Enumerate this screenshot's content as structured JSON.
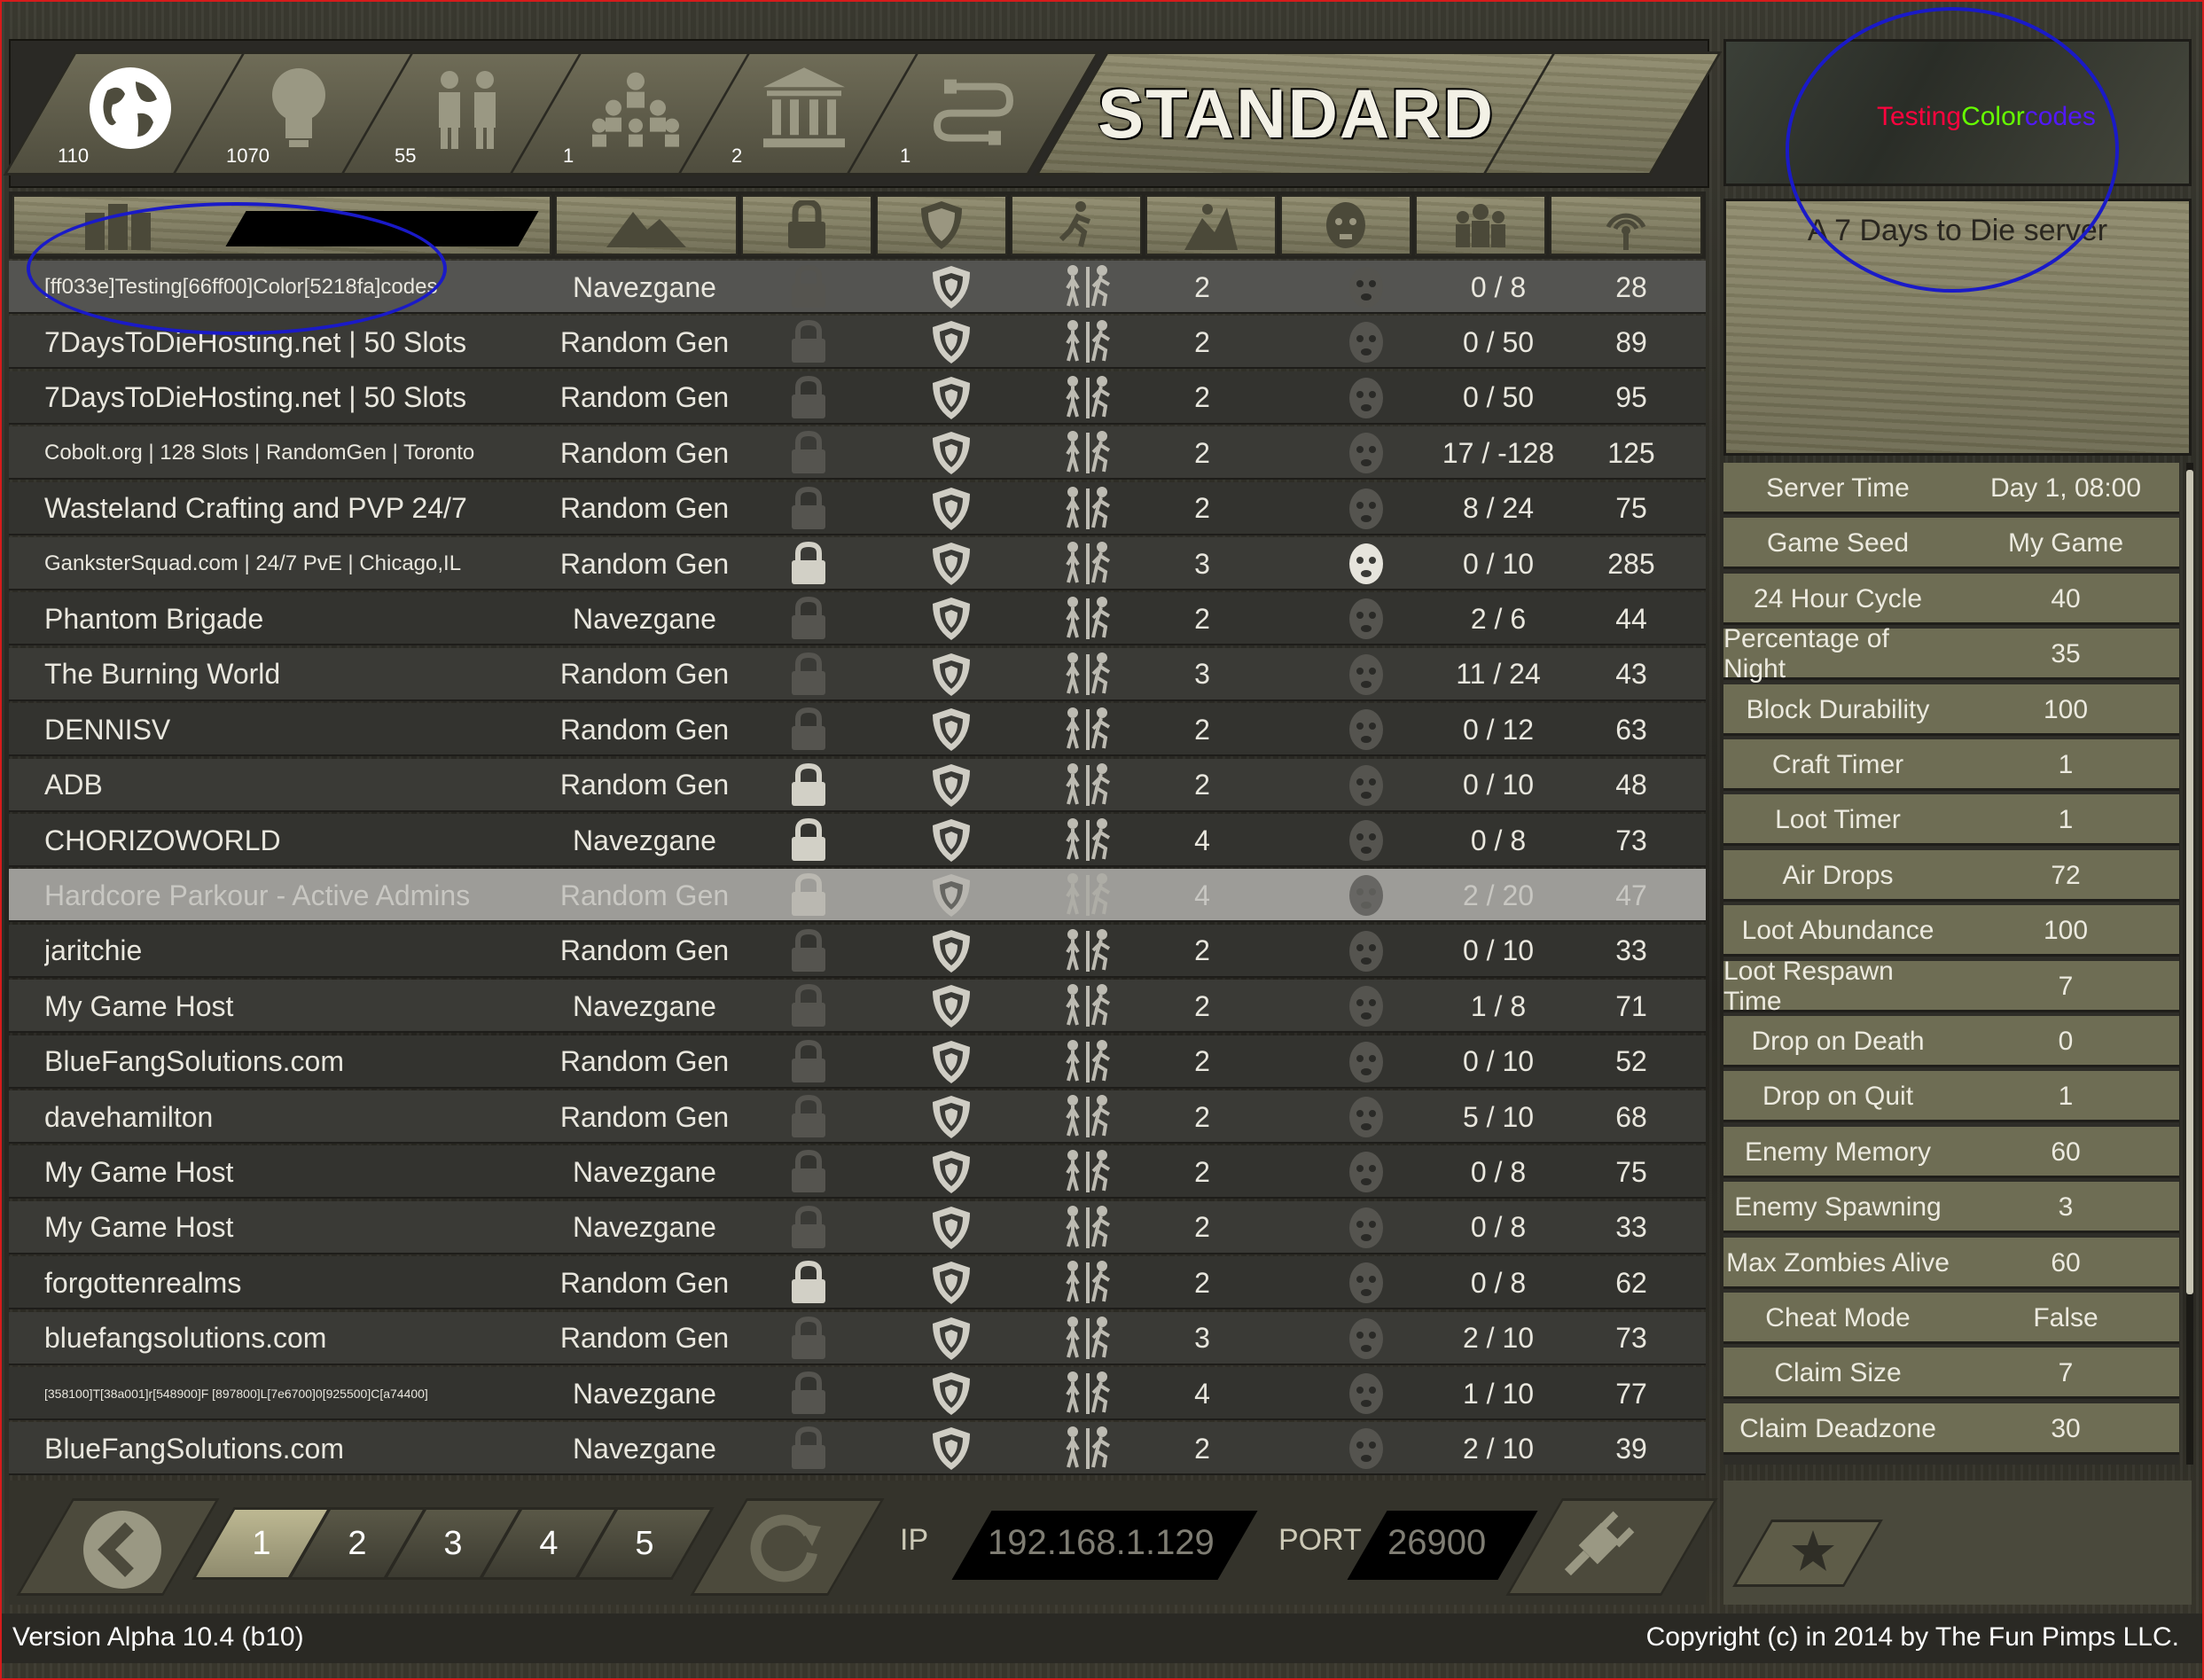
{
  "tabs": [
    {
      "icon": "globe-icon",
      "count": "110"
    },
    {
      "icon": "lightbulb-icon",
      "count": "1070"
    },
    {
      "icon": "friends-icon",
      "count": "55"
    },
    {
      "icon": "group-icon",
      "count": "1"
    },
    {
      "icon": "bank-icon",
      "count": "2"
    },
    {
      "icon": "lan-icon",
      "count": "1"
    }
  ],
  "mode_label": "STANDARD",
  "columns": [
    "server-name",
    "world",
    "password",
    "anticheat",
    "sprint",
    "difficulty",
    "zombie-run",
    "players",
    "ping"
  ],
  "servers": [
    {
      "name": "[ff033e]Testing[66ff00]Color[5218fa]codes",
      "world": "Navezgane",
      "locked": false,
      "difficulty": "2",
      "zombie": "dim",
      "players": "0 / 8",
      "ping": "28",
      "style": "hl",
      "size": "small"
    },
    {
      "name": "7DaysToDieHosting.net | 50 Slots",
      "world": "Random Gen",
      "locked": false,
      "difficulty": "2",
      "zombie": "dim",
      "players": "0 / 50",
      "ping": "89",
      "style": "",
      "size": ""
    },
    {
      "name": "7DaysToDieHosting.net | 50 Slots",
      "world": "Random Gen",
      "locked": false,
      "difficulty": "2",
      "zombie": "dim",
      "players": "0 / 50",
      "ping": "95",
      "style": "",
      "size": ""
    },
    {
      "name": "Cobolt.org | 128 Slots | RandomGen | Toronto",
      "world": "Random Gen",
      "locked": false,
      "difficulty": "2",
      "zombie": "dim",
      "players": "17 / -128",
      "ping": "125",
      "style": "",
      "size": "small"
    },
    {
      "name": "Wasteland Crafting and PVP 24/7",
      "world": "Random Gen",
      "locked": false,
      "difficulty": "2",
      "zombie": "dim",
      "players": "8 / 24",
      "ping": "75",
      "style": "",
      "size": ""
    },
    {
      "name": "GanksterSquad.com | 24/7 PvE | Chicago,IL",
      "world": "Random Gen",
      "locked": true,
      "difficulty": "3",
      "zombie": "bright",
      "players": "0 / 10",
      "ping": "285",
      "style": "",
      "size": "small"
    },
    {
      "name": "Phantom Brigade",
      "world": "Navezgane",
      "locked": false,
      "difficulty": "2",
      "zombie": "dim",
      "players": "2 / 6",
      "ping": "44",
      "style": "",
      "size": ""
    },
    {
      "name": "The Burning World",
      "world": "Random Gen",
      "locked": false,
      "difficulty": "3",
      "zombie": "dim",
      "players": "11 / 24",
      "ping": "43",
      "style": "",
      "size": ""
    },
    {
      "name": "DENNISV",
      "world": "Random Gen",
      "locked": false,
      "difficulty": "2",
      "zombie": "dim",
      "players": "0 / 12",
      "ping": "63",
      "style": "",
      "size": ""
    },
    {
      "name": "ADB",
      "world": "Random Gen",
      "locked": true,
      "difficulty": "2",
      "zombie": "dim",
      "players": "0 / 10",
      "ping": "48",
      "style": "",
      "size": ""
    },
    {
      "name": "CHORIZOWORLD",
      "world": "Navezgane",
      "locked": true,
      "difficulty": "4",
      "zombie": "dim",
      "players": "0 / 8",
      "ping": "73",
      "style": "",
      "size": ""
    },
    {
      "name": "Hardcore Parkour - Active Admins",
      "world": "Random Gen",
      "locked": true,
      "difficulty": "4",
      "zombie": "dark",
      "players": "2 / 20",
      "ping": "47",
      "style": "disabled",
      "size": ""
    },
    {
      "name": "jaritchie",
      "world": "Random Gen",
      "locked": false,
      "difficulty": "2",
      "zombie": "dim",
      "players": "0 / 10",
      "ping": "33",
      "style": "",
      "size": ""
    },
    {
      "name": "My Game Host",
      "world": "Navezgane",
      "locked": false,
      "difficulty": "2",
      "zombie": "dim",
      "players": "1 / 8",
      "ping": "71",
      "style": "",
      "size": ""
    },
    {
      "name": "BlueFangSolutions.com",
      "world": "Random Gen",
      "locked": false,
      "difficulty": "2",
      "zombie": "dim",
      "players": "0 / 10",
      "ping": "52",
      "style": "",
      "size": ""
    },
    {
      "name": "davehamilton",
      "world": "Random Gen",
      "locked": false,
      "difficulty": "2",
      "zombie": "dim",
      "players": "5 / 10",
      "ping": "68",
      "style": "",
      "size": ""
    },
    {
      "name": "My Game Host",
      "world": "Navezgane",
      "locked": false,
      "difficulty": "2",
      "zombie": "dim",
      "players": "0 / 8",
      "ping": "75",
      "style": "",
      "size": ""
    },
    {
      "name": "My Game Host",
      "world": "Navezgane",
      "locked": false,
      "difficulty": "2",
      "zombie": "dim",
      "players": "0 / 8",
      "ping": "33",
      "style": "",
      "size": ""
    },
    {
      "name": "forgottenrealms",
      "world": "Random Gen",
      "locked": true,
      "difficulty": "2",
      "zombie": "dim",
      "players": "0 / 8",
      "ping": "62",
      "style": "",
      "size": ""
    },
    {
      "name": "bluefangsolutions.com",
      "world": "Random Gen",
      "locked": false,
      "difficulty": "3",
      "zombie": "dim",
      "players": "2 / 10",
      "ping": "73",
      "style": "",
      "size": ""
    },
    {
      "name": "[358100]T[38a001]r[548900]F [897800]L[7e6700]0[925500]C[a74400]",
      "world": "Navezgane",
      "locked": false,
      "difficulty": "4",
      "zombie": "dim",
      "players": "1 / 10",
      "ping": "77",
      "style": "",
      "size": "tiny"
    },
    {
      "name": "BlueFangSolutions.com",
      "world": "Navezgane",
      "locked": false,
      "difficulty": "2",
      "zombie": "dim",
      "players": "2 / 10",
      "ping": "39",
      "style": "",
      "size": ""
    }
  ],
  "pagination": {
    "pages": [
      "1",
      "2",
      "3",
      "4",
      "5"
    ],
    "active": "1"
  },
  "connect": {
    "ip_label": "IP",
    "ip_value": "192.168.1.129",
    "port_label": "PORT",
    "port_value": "26900"
  },
  "selected": {
    "title_parts": [
      {
        "text": "Testing",
        "color": "#ff033e"
      },
      {
        "text": "Color",
        "color": "#66ff00"
      },
      {
        "text": "codes",
        "color": "#5218fa"
      }
    ],
    "description": "A 7 Days to Die server"
  },
  "stats": [
    {
      "k": "Server Time",
      "v": "Day 1, 08:00"
    },
    {
      "k": "Game Seed",
      "v": "My Game"
    },
    {
      "k": "24 Hour Cycle",
      "v": "40"
    },
    {
      "k": "Percentage of Night",
      "v": "35"
    },
    {
      "k": "Block Durability",
      "v": "100"
    },
    {
      "k": "Craft Timer",
      "v": "1"
    },
    {
      "k": "Loot Timer",
      "v": "1"
    },
    {
      "k": "Air Drops",
      "v": "72"
    },
    {
      "k": "Loot Abundance",
      "v": "100"
    },
    {
      "k": "Loot Respawn Time",
      "v": "7"
    },
    {
      "k": "Drop on Death",
      "v": "0"
    },
    {
      "k": "Drop on Quit",
      "v": "1"
    },
    {
      "k": "Enemy Memory",
      "v": "60"
    },
    {
      "k": "Enemy Spawning",
      "v": "3"
    },
    {
      "k": "Max Zombies Alive",
      "v": "60"
    },
    {
      "k": "Cheat Mode",
      "v": "False"
    },
    {
      "k": "Claim Size",
      "v": "7"
    },
    {
      "k": "Claim Deadzone",
      "v": "30"
    }
  ],
  "footer": {
    "version": "Version Alpha 10.4 (b10)",
    "copyright": "Copyright (c) in 2014 by The Fun Pimps LLC."
  },
  "colors": {
    "annotation": "#1a1ac8",
    "frame": "#d61b1b",
    "row": "#33332f",
    "panel": "#6e6d54"
  }
}
